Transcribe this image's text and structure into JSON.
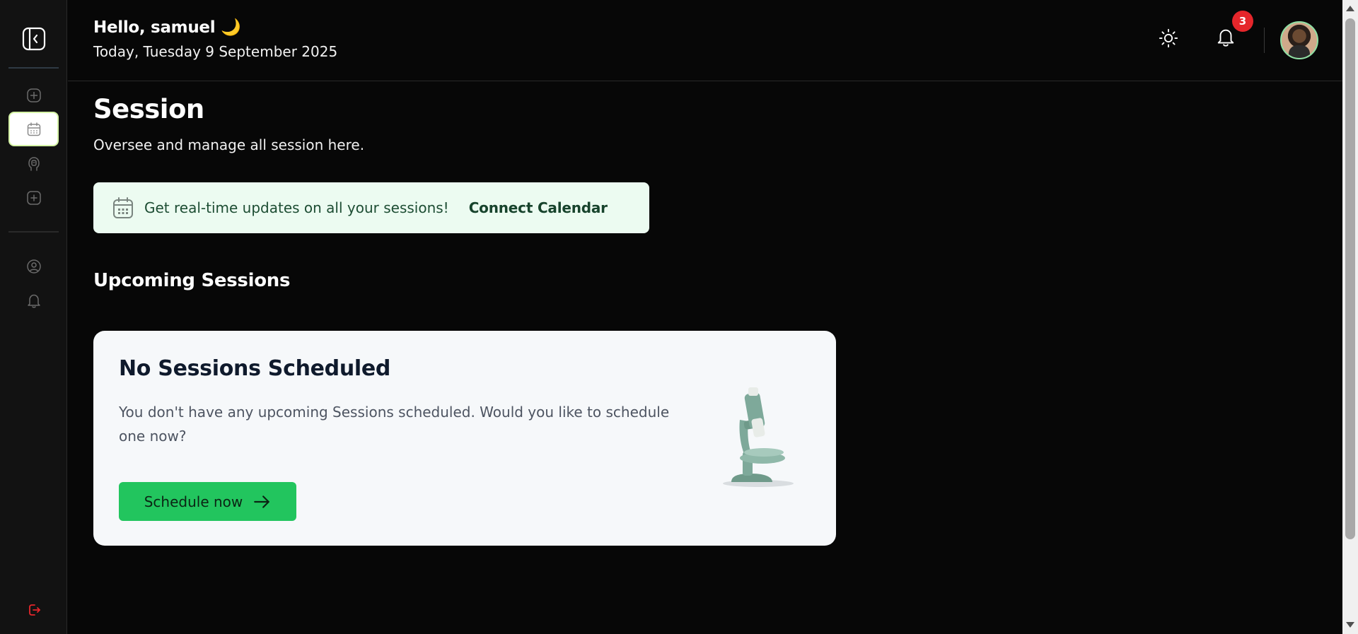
{
  "sidebar": {
    "items": [
      {
        "name": "dashboard",
        "icon": "dashboard-icon"
      },
      {
        "name": "sessions",
        "icon": "calendar-icon",
        "active": true
      },
      {
        "name": "mentors",
        "icon": "mentor-icon"
      },
      {
        "name": "add",
        "icon": "plus-square-icon"
      },
      {
        "name": "profile",
        "icon": "user-circle-icon"
      },
      {
        "name": "notifications",
        "icon": "bell-icon"
      }
    ],
    "logout_icon": "logout-icon",
    "accent": "#d5f3a6"
  },
  "header": {
    "greeting": "Hello, samuel 🌙",
    "date": "Today, Tuesday 9 September 2025",
    "notification_count": "3",
    "theme_icon": "sun-icon",
    "bell_icon": "bell-icon"
  },
  "page": {
    "title": "Session",
    "subtitle": "Oversee and manage all session here."
  },
  "banner": {
    "text": "Get real-time updates on all your sessions!",
    "link": "Connect Calendar",
    "background": "#ecfbf1"
  },
  "upcoming": {
    "title": "Upcoming Sessions",
    "empty_title": "No Sessions Scheduled",
    "empty_desc": "You don't have any upcoming Sessions scheduled. Would you like to schedule one now?",
    "button_label": "Schedule now",
    "button_color": "#22c55e"
  }
}
